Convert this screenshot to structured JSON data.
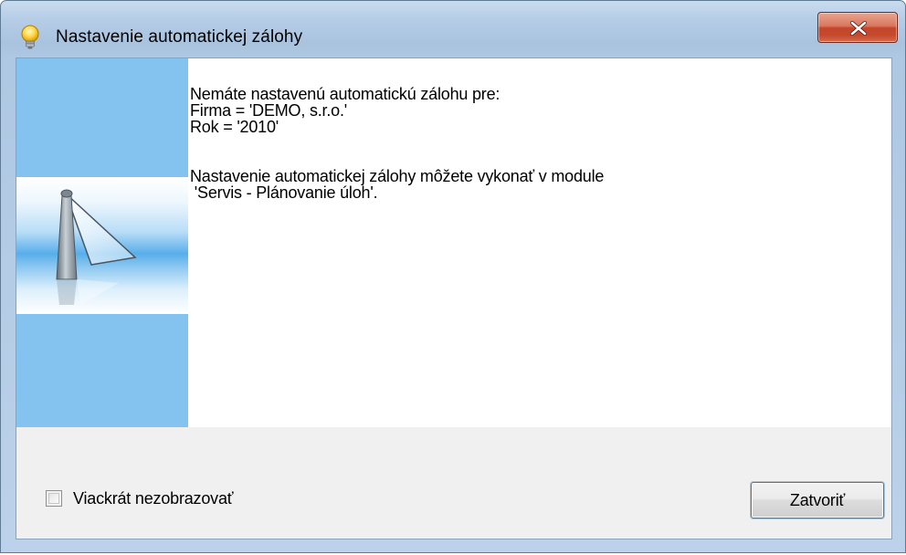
{
  "window": {
    "title": "Nastavenie automatickej zálohy",
    "title_icon": "lightbulb-icon",
    "close_icon": "close-icon"
  },
  "message": {
    "lines": [
      "Nemáte nastavenú automatickú zálohu pre:",
      "Firma = 'DEMO, s.r.o.'",
      "Rok = '2010'",
      "Nastavenie automatickej zálohy môžete vykonať v module",
      " 'Servis - Plánovanie úloh'."
    ]
  },
  "side_image": {
    "icon": "lighthouse-icon"
  },
  "footer": {
    "checkbox_label": "Viackrát nezobrazovať",
    "checkbox_checked": false,
    "close_button_label": "Zatvoriť"
  },
  "colors": {
    "side_panel": "#84c2f0",
    "close_button_red": "#c4472b",
    "title_frame": "#b6cde6"
  }
}
